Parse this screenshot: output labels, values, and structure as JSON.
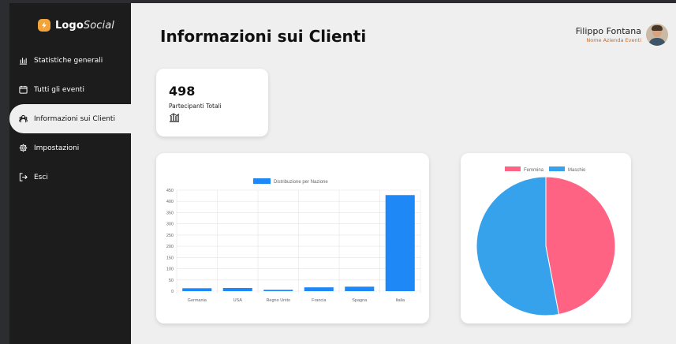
{
  "app": {
    "logo_bold": "Logo",
    "logo_light": "Social",
    "accent_color": "#f2a33a"
  },
  "sidebar": {
    "items": [
      {
        "label": "Statistiche generali",
        "icon": "chart-columns-icon",
        "active": false
      },
      {
        "label": "Tutti gli eventi",
        "icon": "calendar-icon",
        "active": false
      },
      {
        "label": "Informazioni sui Clienti",
        "icon": "users-icon",
        "active": true
      },
      {
        "label": "Impostazioni",
        "icon": "gear-icon",
        "active": false
      },
      {
        "label": "Esci",
        "icon": "logout-icon",
        "active": false
      }
    ]
  },
  "header": {
    "title": "Informazioni sui Clienti"
  },
  "user": {
    "name": "Filippo Fontana",
    "company": "Nome Azienda Eventi"
  },
  "stat_card": {
    "value": "498",
    "label": "Partecipanti Totali",
    "icon": "chart-columns-icon"
  },
  "chart_data": [
    {
      "type": "bar",
      "legend": "Distribuzione per Nazione",
      "categories": [
        "Germania",
        "USA",
        "Regno Unito",
        "Francia",
        "Spagna",
        "Italia"
      ],
      "values": [
        13,
        14,
        6,
        17,
        20,
        428
      ],
      "ylim": [
        0,
        450
      ],
      "yticks": [
        "0",
        "50",
        "100",
        "150",
        "200",
        "250",
        "300",
        "350",
        "400",
        "450"
      ],
      "grid": true,
      "legend_position": "top",
      "color": "#1e88f7"
    },
    {
      "type": "pie",
      "labels": [
        "Femmina",
        "Maschio"
      ],
      "values": [
        47,
        53
      ],
      "colors": [
        "#ff6384",
        "#36a2eb"
      ],
      "legend_position": "top"
    }
  ]
}
